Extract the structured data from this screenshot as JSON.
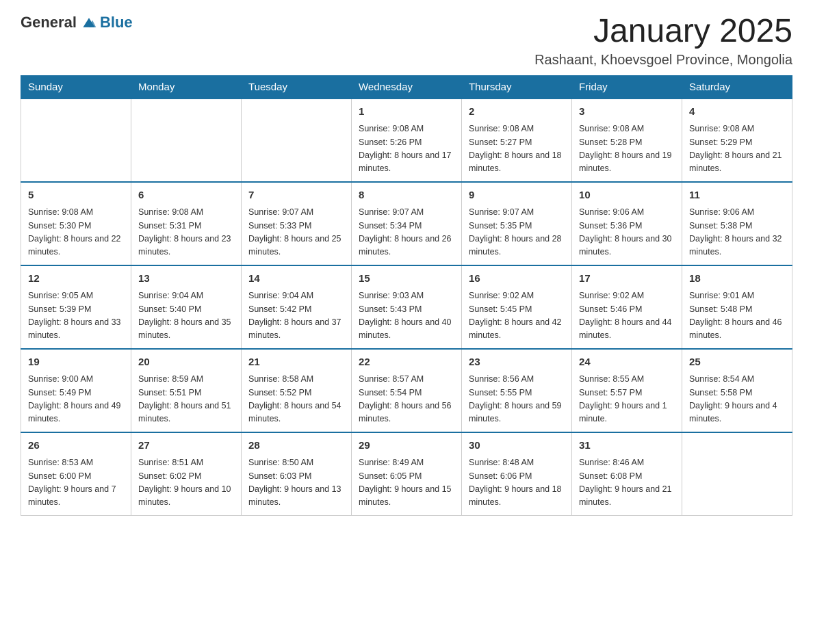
{
  "logo": {
    "text_general": "General",
    "text_blue": "Blue"
  },
  "title": "January 2025",
  "subtitle": "Rashaant, Khoevsgoel Province, Mongolia",
  "days_of_week": [
    "Sunday",
    "Monday",
    "Tuesday",
    "Wednesday",
    "Thursday",
    "Friday",
    "Saturday"
  ],
  "weeks": [
    [
      {
        "day": "",
        "sunrise": "",
        "sunset": "",
        "daylight": ""
      },
      {
        "day": "",
        "sunrise": "",
        "sunset": "",
        "daylight": ""
      },
      {
        "day": "",
        "sunrise": "",
        "sunset": "",
        "daylight": ""
      },
      {
        "day": "1",
        "sunrise": "9:08 AM",
        "sunset": "5:26 PM",
        "daylight": "8 hours and 17 minutes."
      },
      {
        "day": "2",
        "sunrise": "9:08 AM",
        "sunset": "5:27 PM",
        "daylight": "8 hours and 18 minutes."
      },
      {
        "day": "3",
        "sunrise": "9:08 AM",
        "sunset": "5:28 PM",
        "daylight": "8 hours and 19 minutes."
      },
      {
        "day": "4",
        "sunrise": "9:08 AM",
        "sunset": "5:29 PM",
        "daylight": "8 hours and 21 minutes."
      }
    ],
    [
      {
        "day": "5",
        "sunrise": "9:08 AM",
        "sunset": "5:30 PM",
        "daylight": "8 hours and 22 minutes."
      },
      {
        "day": "6",
        "sunrise": "9:08 AM",
        "sunset": "5:31 PM",
        "daylight": "8 hours and 23 minutes."
      },
      {
        "day": "7",
        "sunrise": "9:07 AM",
        "sunset": "5:33 PM",
        "daylight": "8 hours and 25 minutes."
      },
      {
        "day": "8",
        "sunrise": "9:07 AM",
        "sunset": "5:34 PM",
        "daylight": "8 hours and 26 minutes."
      },
      {
        "day": "9",
        "sunrise": "9:07 AM",
        "sunset": "5:35 PM",
        "daylight": "8 hours and 28 minutes."
      },
      {
        "day": "10",
        "sunrise": "9:06 AM",
        "sunset": "5:36 PM",
        "daylight": "8 hours and 30 minutes."
      },
      {
        "day": "11",
        "sunrise": "9:06 AM",
        "sunset": "5:38 PM",
        "daylight": "8 hours and 32 minutes."
      }
    ],
    [
      {
        "day": "12",
        "sunrise": "9:05 AM",
        "sunset": "5:39 PM",
        "daylight": "8 hours and 33 minutes."
      },
      {
        "day": "13",
        "sunrise": "9:04 AM",
        "sunset": "5:40 PM",
        "daylight": "8 hours and 35 minutes."
      },
      {
        "day": "14",
        "sunrise": "9:04 AM",
        "sunset": "5:42 PM",
        "daylight": "8 hours and 37 minutes."
      },
      {
        "day": "15",
        "sunrise": "9:03 AM",
        "sunset": "5:43 PM",
        "daylight": "8 hours and 40 minutes."
      },
      {
        "day": "16",
        "sunrise": "9:02 AM",
        "sunset": "5:45 PM",
        "daylight": "8 hours and 42 minutes."
      },
      {
        "day": "17",
        "sunrise": "9:02 AM",
        "sunset": "5:46 PM",
        "daylight": "8 hours and 44 minutes."
      },
      {
        "day": "18",
        "sunrise": "9:01 AM",
        "sunset": "5:48 PM",
        "daylight": "8 hours and 46 minutes."
      }
    ],
    [
      {
        "day": "19",
        "sunrise": "9:00 AM",
        "sunset": "5:49 PM",
        "daylight": "8 hours and 49 minutes."
      },
      {
        "day": "20",
        "sunrise": "8:59 AM",
        "sunset": "5:51 PM",
        "daylight": "8 hours and 51 minutes."
      },
      {
        "day": "21",
        "sunrise": "8:58 AM",
        "sunset": "5:52 PM",
        "daylight": "8 hours and 54 minutes."
      },
      {
        "day": "22",
        "sunrise": "8:57 AM",
        "sunset": "5:54 PM",
        "daylight": "8 hours and 56 minutes."
      },
      {
        "day": "23",
        "sunrise": "8:56 AM",
        "sunset": "5:55 PM",
        "daylight": "8 hours and 59 minutes."
      },
      {
        "day": "24",
        "sunrise": "8:55 AM",
        "sunset": "5:57 PM",
        "daylight": "9 hours and 1 minute."
      },
      {
        "day": "25",
        "sunrise": "8:54 AM",
        "sunset": "5:58 PM",
        "daylight": "9 hours and 4 minutes."
      }
    ],
    [
      {
        "day": "26",
        "sunrise": "8:53 AM",
        "sunset": "6:00 PM",
        "daylight": "9 hours and 7 minutes."
      },
      {
        "day": "27",
        "sunrise": "8:51 AM",
        "sunset": "6:02 PM",
        "daylight": "9 hours and 10 minutes."
      },
      {
        "day": "28",
        "sunrise": "8:50 AM",
        "sunset": "6:03 PM",
        "daylight": "9 hours and 13 minutes."
      },
      {
        "day": "29",
        "sunrise": "8:49 AM",
        "sunset": "6:05 PM",
        "daylight": "9 hours and 15 minutes."
      },
      {
        "day": "30",
        "sunrise": "8:48 AM",
        "sunset": "6:06 PM",
        "daylight": "9 hours and 18 minutes."
      },
      {
        "day": "31",
        "sunrise": "8:46 AM",
        "sunset": "6:08 PM",
        "daylight": "9 hours and 21 minutes."
      },
      {
        "day": "",
        "sunrise": "",
        "sunset": "",
        "daylight": ""
      }
    ]
  ]
}
